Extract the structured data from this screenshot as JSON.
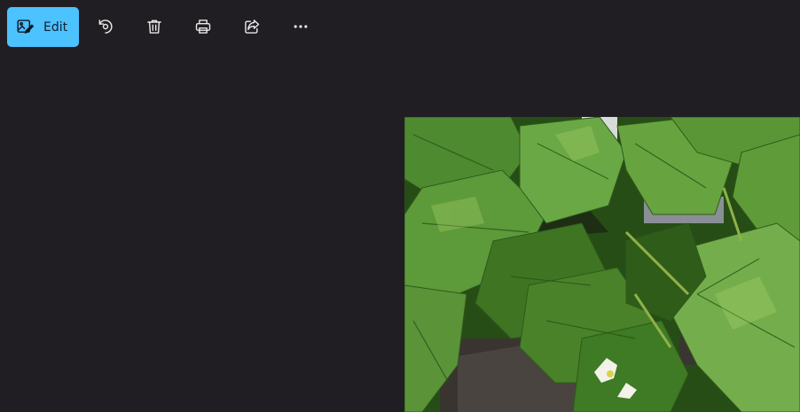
{
  "toolbar": {
    "edit_label": "Edit",
    "buttons": [
      {
        "icon": "rotate-icon"
      },
      {
        "icon": "delete-icon"
      },
      {
        "icon": "print-icon"
      },
      {
        "icon": "share-icon"
      },
      {
        "icon": "more-icon"
      }
    ]
  },
  "colors": {
    "background": "#201e22",
    "accent": "#4cc2ff",
    "icon": "#e8e8e8"
  },
  "photo": {
    "subject": "strawberry-plant-leaves-and-blossom"
  }
}
